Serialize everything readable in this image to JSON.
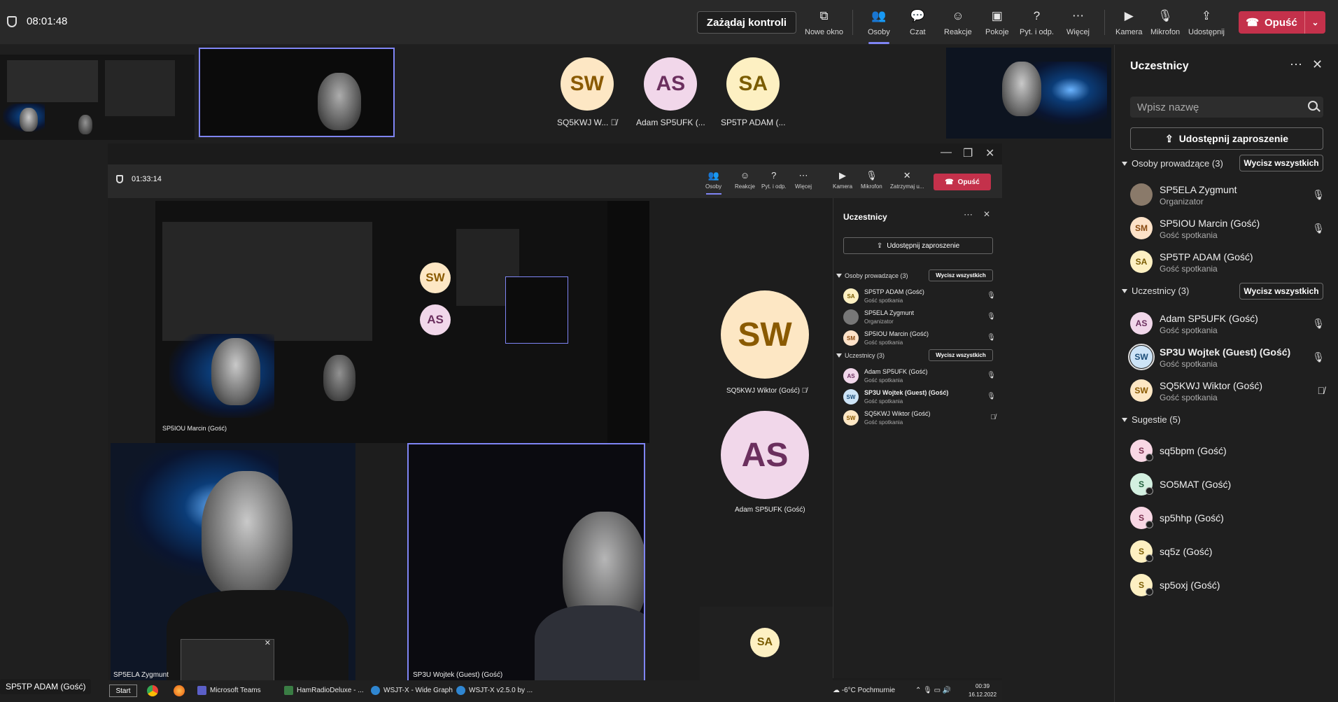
{
  "meeting": {
    "timer": "08:01:48",
    "request_control": "Zażądaj kontroli",
    "leave": "Opuść"
  },
  "toolbar": [
    {
      "label": "Nowe okno",
      "icon": "new-window-icon"
    },
    {
      "label": "Osoby",
      "icon": "people-icon"
    },
    {
      "label": "Czat",
      "icon": "chat-icon"
    },
    {
      "label": "Reakcje",
      "icon": "reactions-icon"
    },
    {
      "label": "Pokoje",
      "icon": "rooms-icon"
    },
    {
      "label": "Pyt. i odp.",
      "icon": "qa-icon"
    },
    {
      "label": "Więcej",
      "icon": "more-icon"
    },
    {
      "label": "Kamera",
      "icon": "camera-icon"
    },
    {
      "label": "Mikrofon",
      "icon": "mic-icon"
    },
    {
      "label": "Udostępnij",
      "icon": "share-icon"
    }
  ],
  "strip": [
    {
      "initials": "SW",
      "label": "SQ5KWJ W...",
      "bg": "#fde7c4",
      "fg": "#8a5a00"
    },
    {
      "initials": "AS",
      "label": "Adam SP5UFK (...",
      "bg": "#f1d7ea",
      "fg": "#6b2f5e"
    },
    {
      "initials": "SA",
      "label": "SP5TP ADAM (...",
      "bg": "#fdf0c2",
      "fg": "#7a5c00"
    }
  ],
  "panel": {
    "title": "Uczestnicy",
    "search_placeholder": "Wpisz nazwę",
    "share_invite": "Udostępnij zaproszenie",
    "mute_all": "Wycisz wszystkich",
    "sections": {
      "presenters": "Osoby prowadzące (3)",
      "attendees": "Uczestnicy (3)",
      "suggestions": "Sugestie (5)"
    },
    "presenters": [
      {
        "initials": "",
        "name": "SP5ELA Zygmunt",
        "sub": "Organizator",
        "bg": "#8a7a6a",
        "fg": "#fff"
      },
      {
        "initials": "SM",
        "name": "SP5IOU Marcin (Gość)",
        "sub": "Gość spotkania",
        "bg": "#fde2c8",
        "fg": "#8a4a10"
      },
      {
        "initials": "SA",
        "name": "SP5TP ADAM (Gość)",
        "sub": "Gość spotkania",
        "bg": "#fdf0c2",
        "fg": "#7a5c00"
      }
    ],
    "attendees": [
      {
        "initials": "AS",
        "name": "Adam SP5UFK (Gość)",
        "sub": "Gość spotkania",
        "bg": "#f1d7ea",
        "fg": "#6b2f5e"
      },
      {
        "initials": "SW",
        "name": "SP3U Wojtek (Guest) (Gość)",
        "sub": "Gość spotkania",
        "bg": "#cde4f7",
        "fg": "#1b4d78"
      },
      {
        "initials": "SW",
        "name": "SQ5KWJ Wiktor (Gość)",
        "sub": "Gość spotkania",
        "bg": "#fde7c4",
        "fg": "#8a5a00"
      }
    ],
    "suggestions": [
      {
        "initials": "S",
        "name": "sq5bpm (Gość)",
        "bg": "#f8d7e4",
        "fg": "#7a2e4d"
      },
      {
        "initials": "S",
        "name": "SO5MAT (Gość)",
        "bg": "#d3f0e0",
        "fg": "#1f5f3b"
      },
      {
        "initials": "S",
        "name": "sp5hhp (Gość)",
        "bg": "#f8d7e4",
        "fg": "#7a2e4d"
      },
      {
        "initials": "S",
        "name": "sq5z (Gość)",
        "bg": "#fdf0c2",
        "fg": "#7a5c00"
      },
      {
        "initials": "S",
        "name": "sp5oxj (Gość)",
        "bg": "#fdf0c2",
        "fg": "#7a5c00"
      }
    ]
  },
  "inner": {
    "timer": "01:33:14",
    "leave": "Opuść",
    "toolbar": [
      {
        "label": "Osoby"
      },
      {
        "label": "Reakcje"
      },
      {
        "label": "Pyt. i odp."
      },
      {
        "label": "Więcej"
      },
      {
        "label": "Kamera"
      },
      {
        "label": "Mikrofon"
      },
      {
        "label": "Zatrzymaj u..."
      }
    ],
    "panel_title": "Uczestnicy",
    "share_invite": "Udostępnij zaproszenie",
    "mute_all": "Wycisz wszystkich",
    "presenters_section": "Osoby prowadzące (3)",
    "attendees_section": "Uczestnicy (3)",
    "presenters": [
      {
        "initials": "SA",
        "name": "SP5TP ADAM (Gość)",
        "sub": "Gość spotkania",
        "bg": "#fdf0c2",
        "fg": "#7a5c00"
      },
      {
        "initials": "",
        "name": "SP5ELA Zygmunt",
        "sub": "Organizator",
        "bg": "#777",
        "fg": "#fff"
      },
      {
        "initials": "SM",
        "name": "SP5IOU Marcin (Gość)",
        "sub": "Gość spotkania",
        "bg": "#fde2c8",
        "fg": "#8a4a10"
      }
    ],
    "attendees": [
      {
        "initials": "AS",
        "name": "Adam SP5UFK (Gość)",
        "sub": "Gość spotkania",
        "bg": "#f1d7ea",
        "fg": "#6b2f5e"
      },
      {
        "initials": "SW",
        "name": "SP3U Wojtek (Guest) (Gość)",
        "sub": "Gość spotkania",
        "bg": "#cde4f7",
        "fg": "#1b4d78"
      },
      {
        "initials": "SW",
        "name": "SQ5KWJ Wiktor (Gość)",
        "sub": "Gość spotkania",
        "bg": "#fde7c4",
        "fg": "#8a5a00"
      }
    ],
    "big_avatars": [
      {
        "initials": "SW",
        "label": "SQ5KWJ Wiktor (Gość)",
        "bg": "#fde7c4",
        "fg": "#8a5a00"
      },
      {
        "initials": "AS",
        "label": "Adam SP5UFK (Gość)",
        "bg": "#f1d7ea",
        "fg": "#6b2f5e"
      },
      {
        "initials": "SA",
        "bg": "#fdf0c2",
        "fg": "#7a5c00"
      }
    ],
    "video_labels": {
      "zygmunt": "SP5ELA Zygmunt",
      "wojtek": "SP3U Wojtek (Guest) (Gość)",
      "marcin": "SP5IOU Marcin (Gość)"
    }
  },
  "speaker_tag": "SP5TP ADAM (Gość)",
  "taskbar": {
    "start": "Start",
    "apps": [
      "Microsoft Teams",
      "HamRadioDeluxe - ...",
      "WSJT-X - Wide Graph",
      "WSJT-X   v2.5.0   by ..."
    ],
    "weather": "-6°C  Pochmurnie",
    "time": "00:39",
    "date": "16.12.2022"
  }
}
